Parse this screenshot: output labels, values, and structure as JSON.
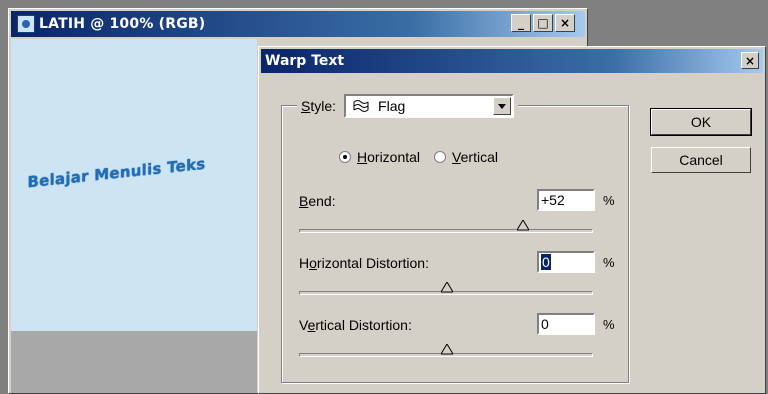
{
  "document": {
    "title": "LATIH @ 100% (RGB)",
    "window_buttons": {
      "minimize": "_",
      "maximize": "□",
      "close": "×"
    },
    "canvas_text": "Belajar Menulis Teks"
  },
  "dialog": {
    "title": "Warp Text",
    "close": "×",
    "style": {
      "label": "Style:",
      "value": "Flag"
    },
    "orientation": {
      "horizontal": "Horizontal",
      "vertical": "Vertical",
      "selected": "horizontal"
    },
    "bend": {
      "label": "Bend:",
      "value": "+52",
      "unit": "%",
      "slider_percent": 76
    },
    "horizontal_distortion": {
      "label": "Horizontal Distortion:",
      "value": "0",
      "unit": "%",
      "slider_percent": 50
    },
    "vertical_distortion": {
      "label": "Vertical Distortion:",
      "value": "0",
      "unit": "%",
      "slider_percent": 50
    },
    "ok": "OK",
    "cancel": "Cancel"
  },
  "colors": {
    "titlebar": "#0a246a",
    "face": "#d4d0c8",
    "canvas": "#cde4f3",
    "warped_text": "#1d6fb8"
  }
}
